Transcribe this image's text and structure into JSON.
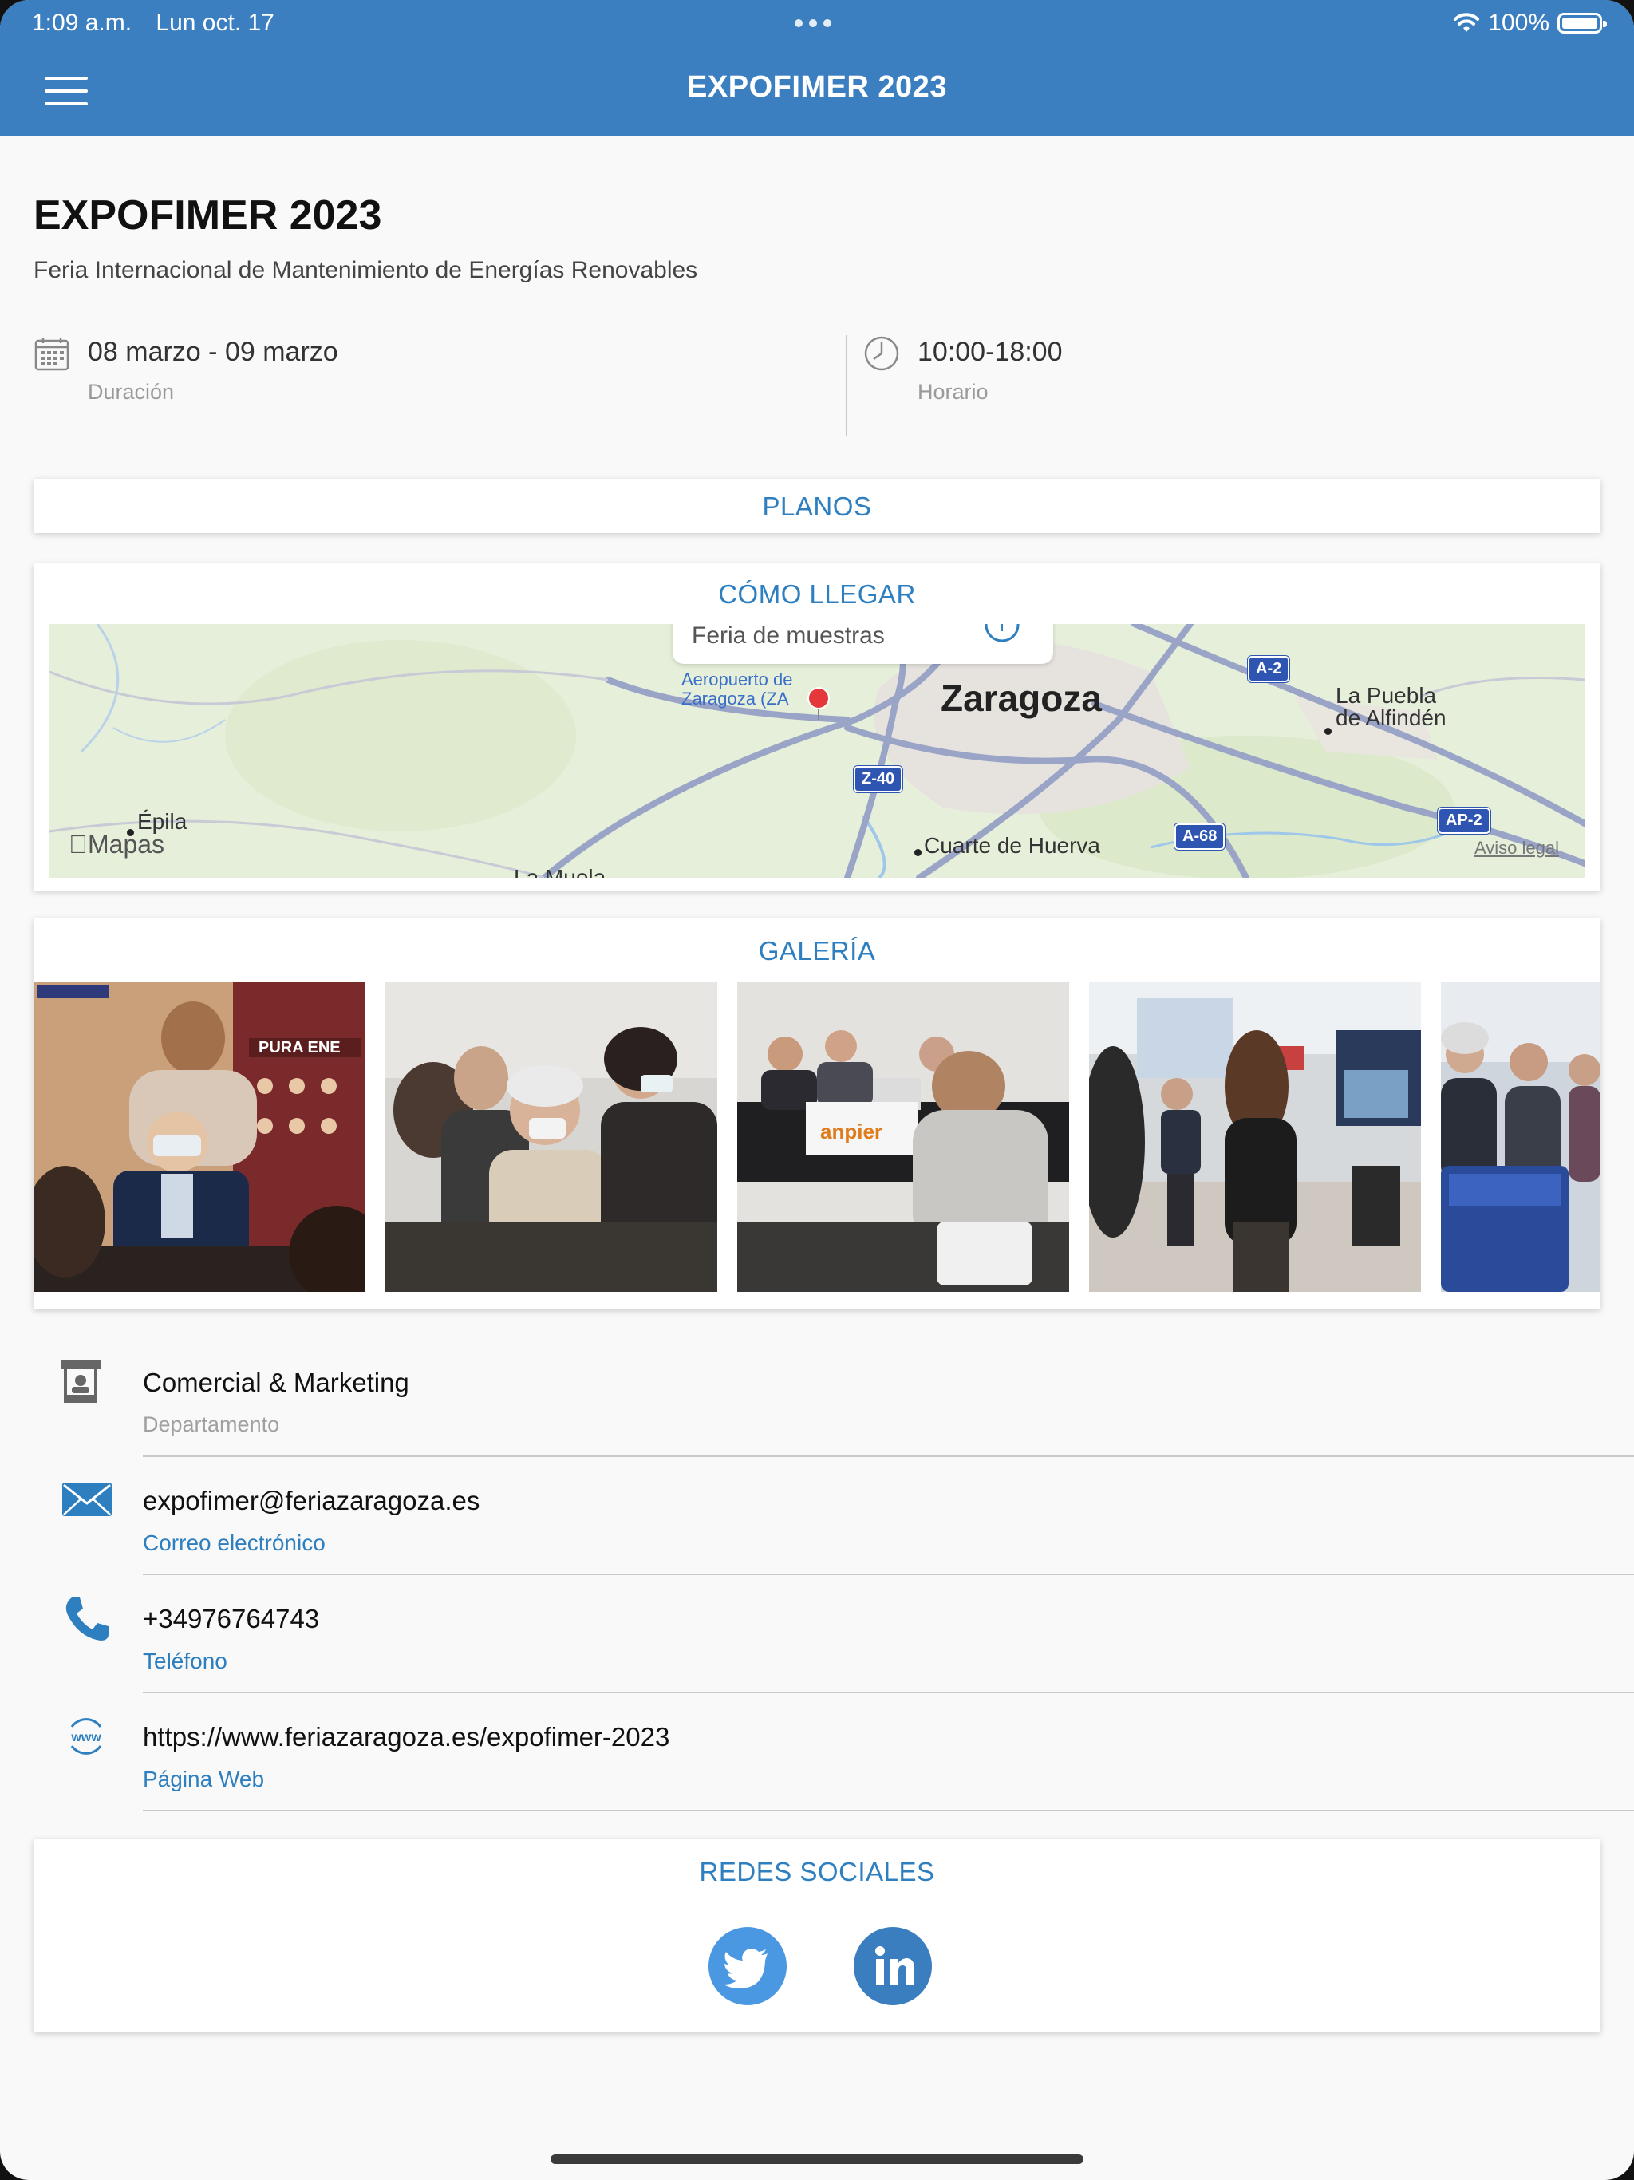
{
  "status_bar": {
    "time": "1:09 a.m.",
    "date": "Lun oct. 17",
    "battery": "100%",
    "battery_level": 1.0
  },
  "nav": {
    "title": "EXPOFIMER 2023",
    "menu_icon": "hamburger-menu-icon"
  },
  "event": {
    "title": "EXPOFIMER 2023",
    "subtitle": "Feria Internacional de Mantenimiento de Energías Renovables",
    "duration_value": "08 marzo - 09 marzo",
    "duration_label": "Duración",
    "schedule_value": "10:00-18:00",
    "schedule_label": "Horario"
  },
  "sections": {
    "planos": "PLANOS",
    "como_llegar": "CÓMO LLEGAR",
    "galeria": "GALERÍA",
    "redes_sociales": "REDES SOCIALES"
  },
  "map": {
    "callout": "Feria de muestras",
    "city": "Zaragoza",
    "airport": "Aeropuerto de",
    "airport2": "Zaragoza (ZA",
    "place1": "La Puebla",
    "place1b": "de Alfindén",
    "place2": "Épila",
    "place3": "Cuarte de Huerva",
    "place4": "La Muela",
    "roads": [
      "A-2",
      "Z-40",
      "A-68",
      "AP-2"
    ],
    "brand": "Mapas",
    "legal": "Aviso legal",
    "colors": {
      "land": "#e5efd9",
      "road": "#9aa4c6",
      "urban": "#e6e3df"
    }
  },
  "gallery": {
    "photos": [
      "photo-1",
      "photo-2",
      "photo-3",
      "photo-4",
      "photo-5"
    ]
  },
  "contacts": [
    {
      "icon": "booth-icon",
      "value": "Comercial & Marketing",
      "label": "Departamento"
    },
    {
      "icon": "email-icon",
      "value": "expofimer@feriazaragoza.es",
      "label": "Correo electrónico"
    },
    {
      "icon": "phone-icon",
      "value": "+34976764743",
      "label": "Teléfono"
    },
    {
      "icon": "www-icon",
      "value": "https://www.feriazaragoza.es/expofimer-2023",
      "label": "Página Web"
    }
  ],
  "social": [
    {
      "name": "twitter-icon",
      "color": "#4a98e1"
    },
    {
      "name": "linkedin-icon",
      "color": "#3a7ec0"
    }
  ],
  "colors": {
    "brand": "#3b7fc0",
    "accent_text": "#2e7fc0",
    "label_gray": "#9a9a9a"
  }
}
